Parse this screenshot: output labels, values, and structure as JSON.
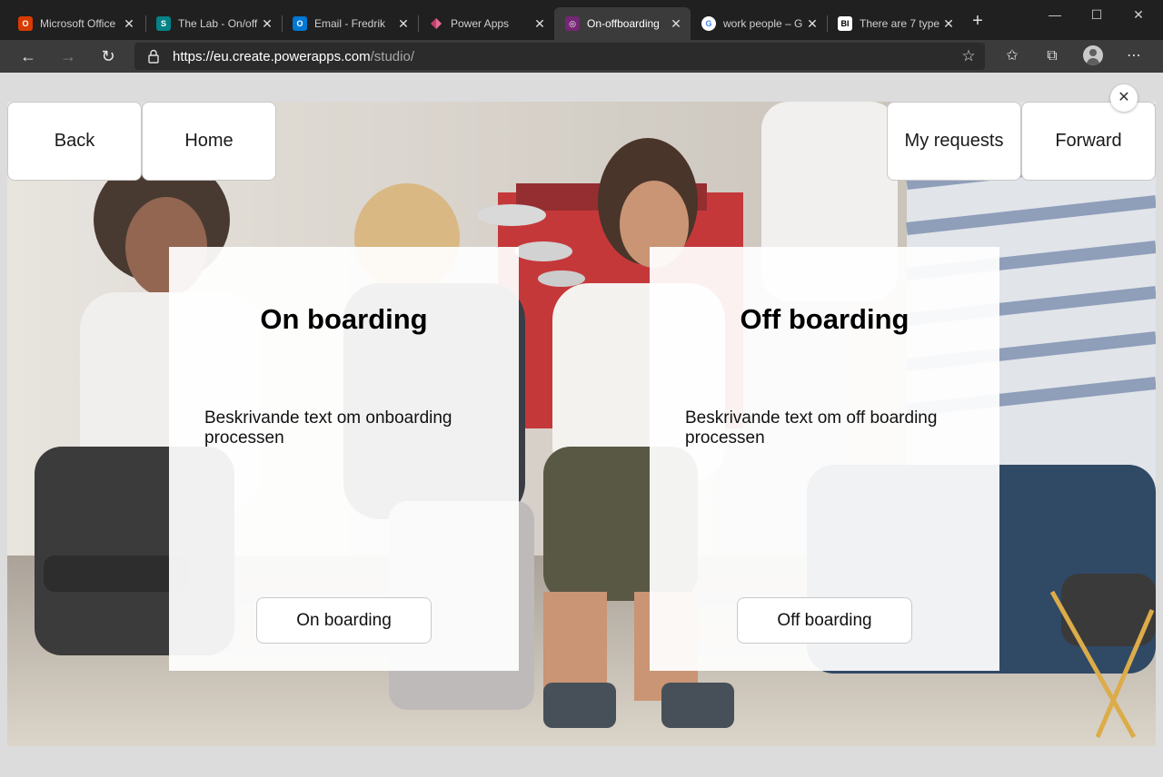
{
  "browser": {
    "tabs": [
      {
        "title": "Microsoft Office",
        "icon": "office-icon",
        "color": "#d83b01",
        "active": false
      },
      {
        "title": "The Lab - On/off",
        "icon": "sharepoint-icon",
        "color": "#038387",
        "active": false
      },
      {
        "title": "Email - Fredrik",
        "icon": "outlook-icon",
        "color": "#0078d4",
        "active": false
      },
      {
        "title": "Power Apps",
        "icon": "powerapps-icon",
        "color": "#c43e6c",
        "active": false
      },
      {
        "title": "On-offboarding",
        "icon": "powerapps-canvas-icon",
        "color": "#742774",
        "active": true
      },
      {
        "title": "work people – G",
        "icon": "google-icon",
        "color": "#4285f4",
        "active": false
      },
      {
        "title": "There are 7 type",
        "icon": "business-insider-icon",
        "color": "#ffffff",
        "active": false
      }
    ],
    "address": {
      "url_host": "https://eu.create.powerapps.com",
      "url_path": "/studio/"
    }
  },
  "app": {
    "nav": {
      "back": "Back",
      "home": "Home",
      "my_requests": "My requests",
      "forward": "Forward"
    },
    "onboarding": {
      "title": "On boarding",
      "description": "Beskrivande text om onboarding processen",
      "button": "On boarding"
    },
    "offboarding": {
      "title": "Off boarding",
      "description": "Beskrivande text om off boarding processen",
      "button": "Off boarding"
    }
  },
  "colors": {
    "chrome_dark": "#202020",
    "chrome_toolbar": "#3b3b3b",
    "canvas_bg": "#dcdcdc",
    "wall_red": "#c0282a"
  }
}
